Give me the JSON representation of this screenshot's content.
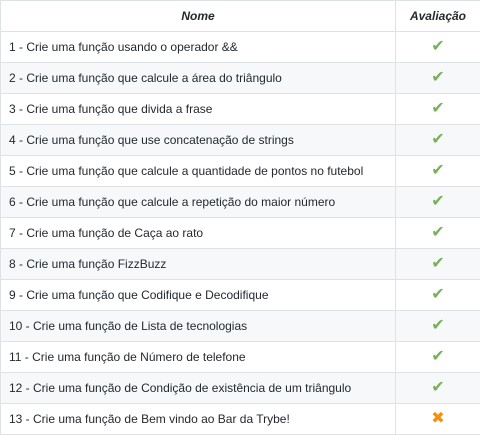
{
  "headers": {
    "name": "Nome",
    "evaluation": "Avaliação"
  },
  "symbols": {
    "pass": "✔",
    "fail": "✖"
  },
  "colors": {
    "pass": "#78b159",
    "fail": "#f4900c",
    "row_alt": "#f6f8fa",
    "border": "#dfe2e5"
  },
  "rows": [
    {
      "name": "1 - Crie uma função usando o operador &&",
      "status": "pass"
    },
    {
      "name": "2 - Crie uma função que calcule a área do triângulo",
      "status": "pass"
    },
    {
      "name": "3 - Crie uma função que divida a frase",
      "status": "pass"
    },
    {
      "name": "4 - Crie uma função que use concatenação de strings",
      "status": "pass"
    },
    {
      "name": "5 - Crie uma função que calcule a quantidade de pontos no futebol",
      "status": "pass"
    },
    {
      "name": "6 - Crie uma função que calcule a repetição do maior número",
      "status": "pass"
    },
    {
      "name": "7 - Crie uma função de Caça ao rato",
      "status": "pass"
    },
    {
      "name": "8 - Crie uma função FizzBuzz",
      "status": "pass"
    },
    {
      "name": "9 - Crie uma função que Codifique e Decodifique",
      "status": "pass"
    },
    {
      "name": "10 - Crie uma função de Lista de tecnologias",
      "status": "pass"
    },
    {
      "name": "11 - Crie uma função de Número de telefone",
      "status": "pass"
    },
    {
      "name": "12 - Crie uma função de Condição de existência de um triângulo",
      "status": "pass"
    },
    {
      "name": "13 - Crie uma função de Bem vindo ao Bar da Trybe!",
      "status": "fail"
    }
  ]
}
